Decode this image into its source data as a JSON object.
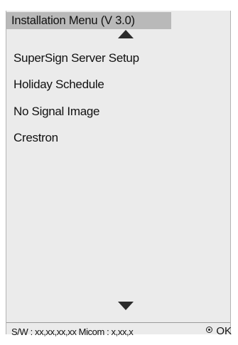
{
  "menu": {
    "title": "Installation Menu (V 3.0)",
    "items": [
      {
        "label": "SuperSign Server Setup"
      },
      {
        "label": "Holiday Schedule"
      },
      {
        "label": "No Signal Image"
      },
      {
        "label": "Crestron"
      }
    ]
  },
  "footer": {
    "version_info": "S/W : xx,xx,xx,xx Micom : x,xx,x",
    "ok_label": "OK",
    "ok_icon": "circle-dot-icon"
  },
  "navigation": {
    "up_icon": "triangle-up-icon",
    "down_icon": "triangle-down-icon"
  },
  "colors": {
    "panel_background": "#ebebeb",
    "title_bar_background": "#b9b9b9",
    "text": "#111111",
    "arrow": "#2b2b2b"
  }
}
